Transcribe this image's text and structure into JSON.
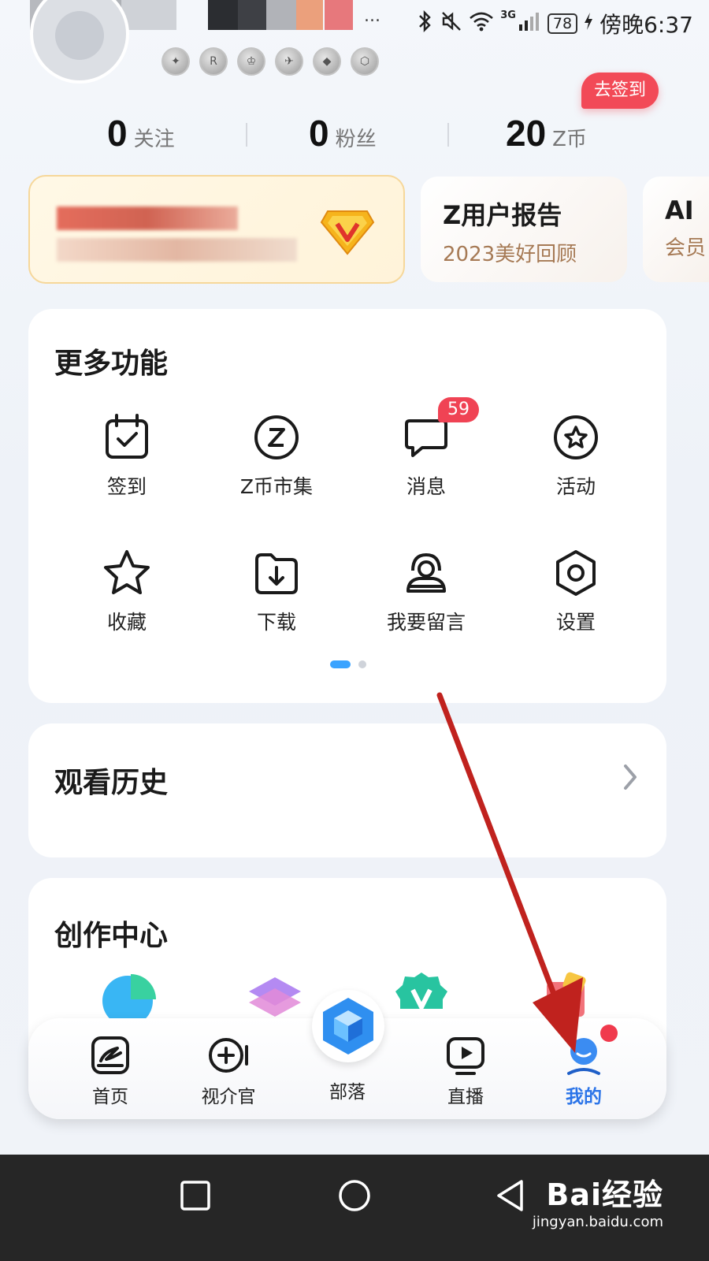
{
  "status_bar": {
    "dots": "...",
    "network": "3G",
    "battery": "78",
    "time": "傍晚6:37"
  },
  "profile": {
    "signin_button": "去签到",
    "stats": [
      {
        "value": "0",
        "label": "关注"
      },
      {
        "value": "0",
        "label": "粉丝"
      },
      {
        "value": "20",
        "label": "Z币"
      }
    ]
  },
  "cards": {
    "report": {
      "title": "Z用户报告",
      "subtitle": "2023美好回顾"
    },
    "ai": {
      "title": "AI",
      "subtitle": "会员"
    }
  },
  "more_features": {
    "title": "更多功能",
    "items": [
      {
        "label": "签到",
        "icon": "calendar-check-icon"
      },
      {
        "label": "Z币市集",
        "icon": "z-coin-icon"
      },
      {
        "label": "消息",
        "icon": "chat-bubble-icon",
        "badge": "59"
      },
      {
        "label": "活动",
        "icon": "star-circle-icon"
      },
      {
        "label": "收藏",
        "icon": "star-icon"
      },
      {
        "label": "下载",
        "icon": "download-folder-icon"
      },
      {
        "label": "我要留言",
        "icon": "headset-icon"
      },
      {
        "label": "设置",
        "icon": "hexagon-settings-icon"
      }
    ]
  },
  "history": {
    "title": "观看历史"
  },
  "creation": {
    "title": "创作中心"
  },
  "bottom_nav": [
    {
      "label": "首页",
      "icon": "home-z-icon"
    },
    {
      "label": "视介官",
      "icon": "video-plus-icon"
    },
    {
      "label": "部落",
      "icon": "cube-icon"
    },
    {
      "label": "直播",
      "icon": "live-play-icon"
    },
    {
      "label": "我的",
      "icon": "profile-icon",
      "active": true
    }
  ],
  "watermark": {
    "brand": "Bai经验",
    "url": "jingyan.baidu.com"
  },
  "colors": {
    "accent_blue": "#2b74e8",
    "badge_red": "#f04354",
    "arrow_red": "#c0221e"
  }
}
